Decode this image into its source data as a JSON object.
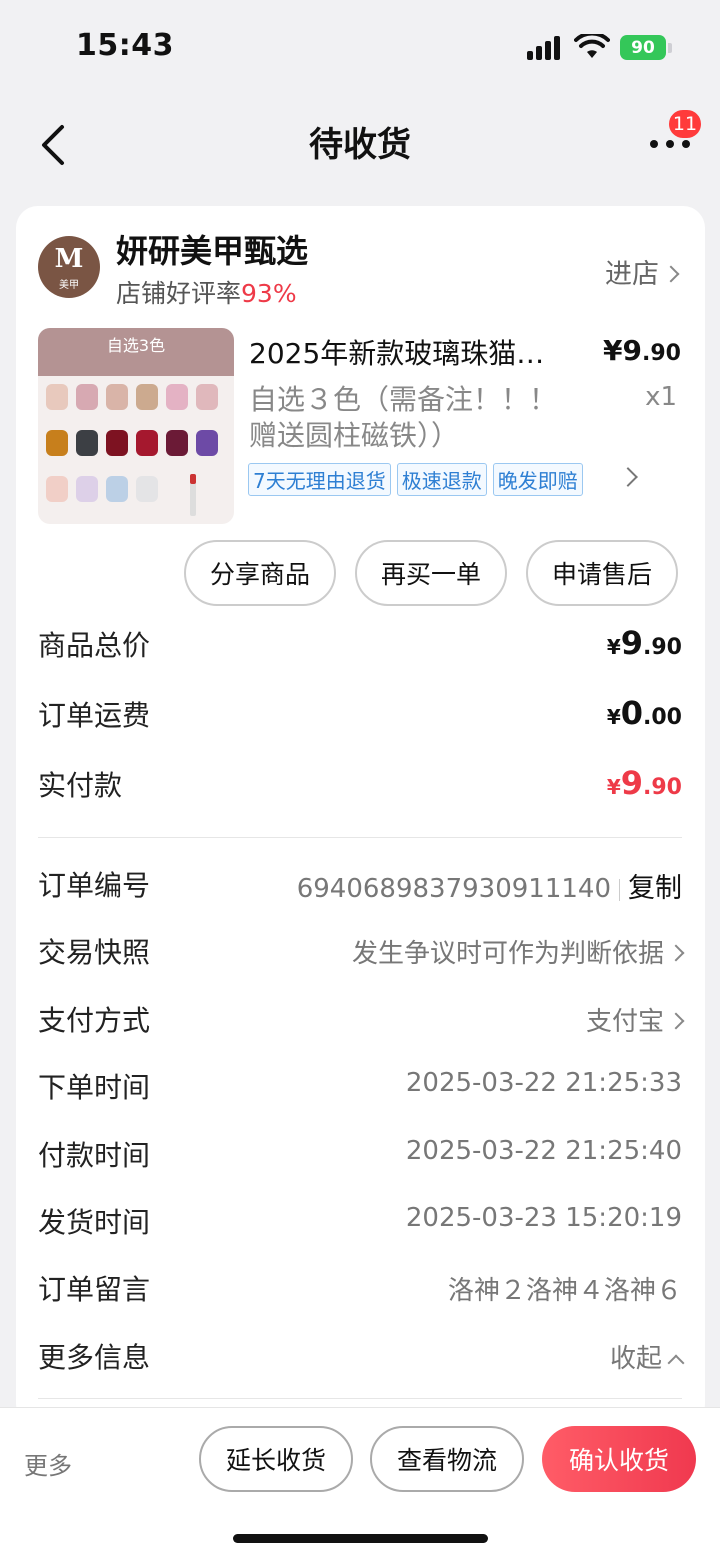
{
  "status_bar": {
    "time": "15:43",
    "battery": "90"
  },
  "nav": {
    "title": "待收货",
    "badge_count": "11"
  },
  "shop": {
    "avatar_letter": "M",
    "avatar_sub": "美甲",
    "name": "妍研美甲甄选",
    "rating_label": "店铺好评率",
    "rating_value": "93%",
    "enter_label": "进店"
  },
  "product": {
    "thumb_title": "自选3色",
    "title": "2025年新款玻璃珠猫…",
    "price_int": "¥9",
    "price_dec": ".90",
    "spec": "自选３色（需备注！！！ 赠送圆柱磁铁））",
    "qty": "x1",
    "tags": [
      "7天无理由退货",
      "极速退款",
      "晚发即赔"
    ]
  },
  "actions": {
    "share": "分享商品",
    "rebuy": "再买一单",
    "after_sale": "申请售后"
  },
  "totals": [
    {
      "label": "商品总价",
      "yen": "¥",
      "int": "9",
      "dec": ".90"
    },
    {
      "label": "订单运费",
      "yen": "¥",
      "int": "0",
      "dec": ".00"
    },
    {
      "label": "实付款",
      "yen": "¥",
      "int": "9",
      "dec": ".90"
    }
  ],
  "details": {
    "order_no_label": "订单编号",
    "order_no": "6940689837930911140",
    "copy_label": "复制",
    "snapshot_label": "交易快照",
    "snapshot_value": "发生争议时可作为判断依据",
    "payment_label": "支付方式",
    "payment_value": "支付宝",
    "order_time_label": "下单时间",
    "order_time": "2025-03-22 21:25:33",
    "pay_time_label": "付款时间",
    "pay_time": "2025-03-22 21:25:40",
    "ship_time_label": "发货时间",
    "ship_time": "2025-03-23 15:20:19",
    "note_label": "订单留言",
    "note_value": "洛神２洛神４洛神６",
    "more_info_label": "更多信息",
    "collapse_label": "收起"
  },
  "bottom_bar": {
    "more": "更多",
    "extend": "延长收货",
    "logistics": "查看物流",
    "confirm": "确认收货"
  },
  "colors": {
    "accent": "#ee3a48",
    "tag_blue": "#2e7fd3",
    "battery_green": "#34c759"
  }
}
